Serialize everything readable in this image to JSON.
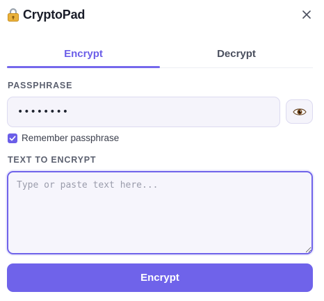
{
  "app": {
    "title": "CryptoPad",
    "logo_icon": "lock-icon",
    "close_icon": "close-icon"
  },
  "tabs": [
    {
      "label": "Encrypt",
      "active": true
    },
    {
      "label": "Decrypt",
      "active": false
    }
  ],
  "passphrase": {
    "label": "PASSPHRASE",
    "value": "••••••••",
    "toggle_icon": "eye-icon"
  },
  "remember": {
    "label": "Remember passphrase",
    "checked": true
  },
  "text_input": {
    "label": "TEXT TO ENCRYPT",
    "placeholder": "Type or paste text here...",
    "value": ""
  },
  "action": {
    "label": "Encrypt"
  },
  "colors": {
    "accent": "#6f63ea",
    "field_bg": "#f5f4fb"
  }
}
